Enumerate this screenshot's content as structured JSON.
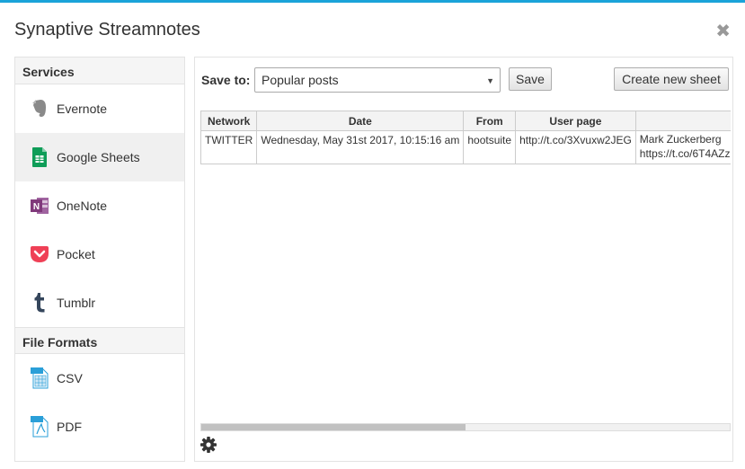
{
  "dialog": {
    "title": "Synaptive Streamnotes",
    "close_glyph": "✖"
  },
  "sidebar": {
    "services_heading": "Services",
    "services": [
      {
        "label": "Evernote",
        "icon": "evernote-icon",
        "active": false
      },
      {
        "label": "Google Sheets",
        "icon": "google-sheets-icon",
        "active": true
      },
      {
        "label": "OneNote",
        "icon": "onenote-icon",
        "active": false
      },
      {
        "label": "Pocket",
        "icon": "pocket-icon",
        "active": false
      },
      {
        "label": "Tumblr",
        "icon": "tumblr-icon",
        "active": false
      }
    ],
    "formats_heading": "File Formats",
    "formats": [
      {
        "label": "CSV",
        "icon": "csv-file-icon"
      },
      {
        "label": "PDF",
        "icon": "pdf-file-icon"
      }
    ]
  },
  "toolbar": {
    "save_to_label": "Save to:",
    "selected_sheet": "Popular posts",
    "save_label": "Save",
    "create_label": "Create new sheet"
  },
  "table": {
    "headers": [
      "Network",
      "Date",
      "From",
      "User page",
      ""
    ],
    "rows": [
      [
        "TWITTER",
        "Wednesday, May 31st 2017, 10:15:16 am",
        "hootsuite",
        "http://t.co/3Xvuxw2JEG",
        "Mark Zuckerberg\nhttps://t.co/6T4AZz"
      ]
    ]
  },
  "scrollbar": {
    "visible_fraction": 0.5
  },
  "colors": {
    "accent": "#1aa3d9",
    "evernote": "#8a8a8a",
    "google_sheets": "#0f9d58",
    "onenote": "#80397b",
    "pocket": "#ef4056",
    "tumblr": "#35465c",
    "file_icon": "#2a9fd8"
  }
}
